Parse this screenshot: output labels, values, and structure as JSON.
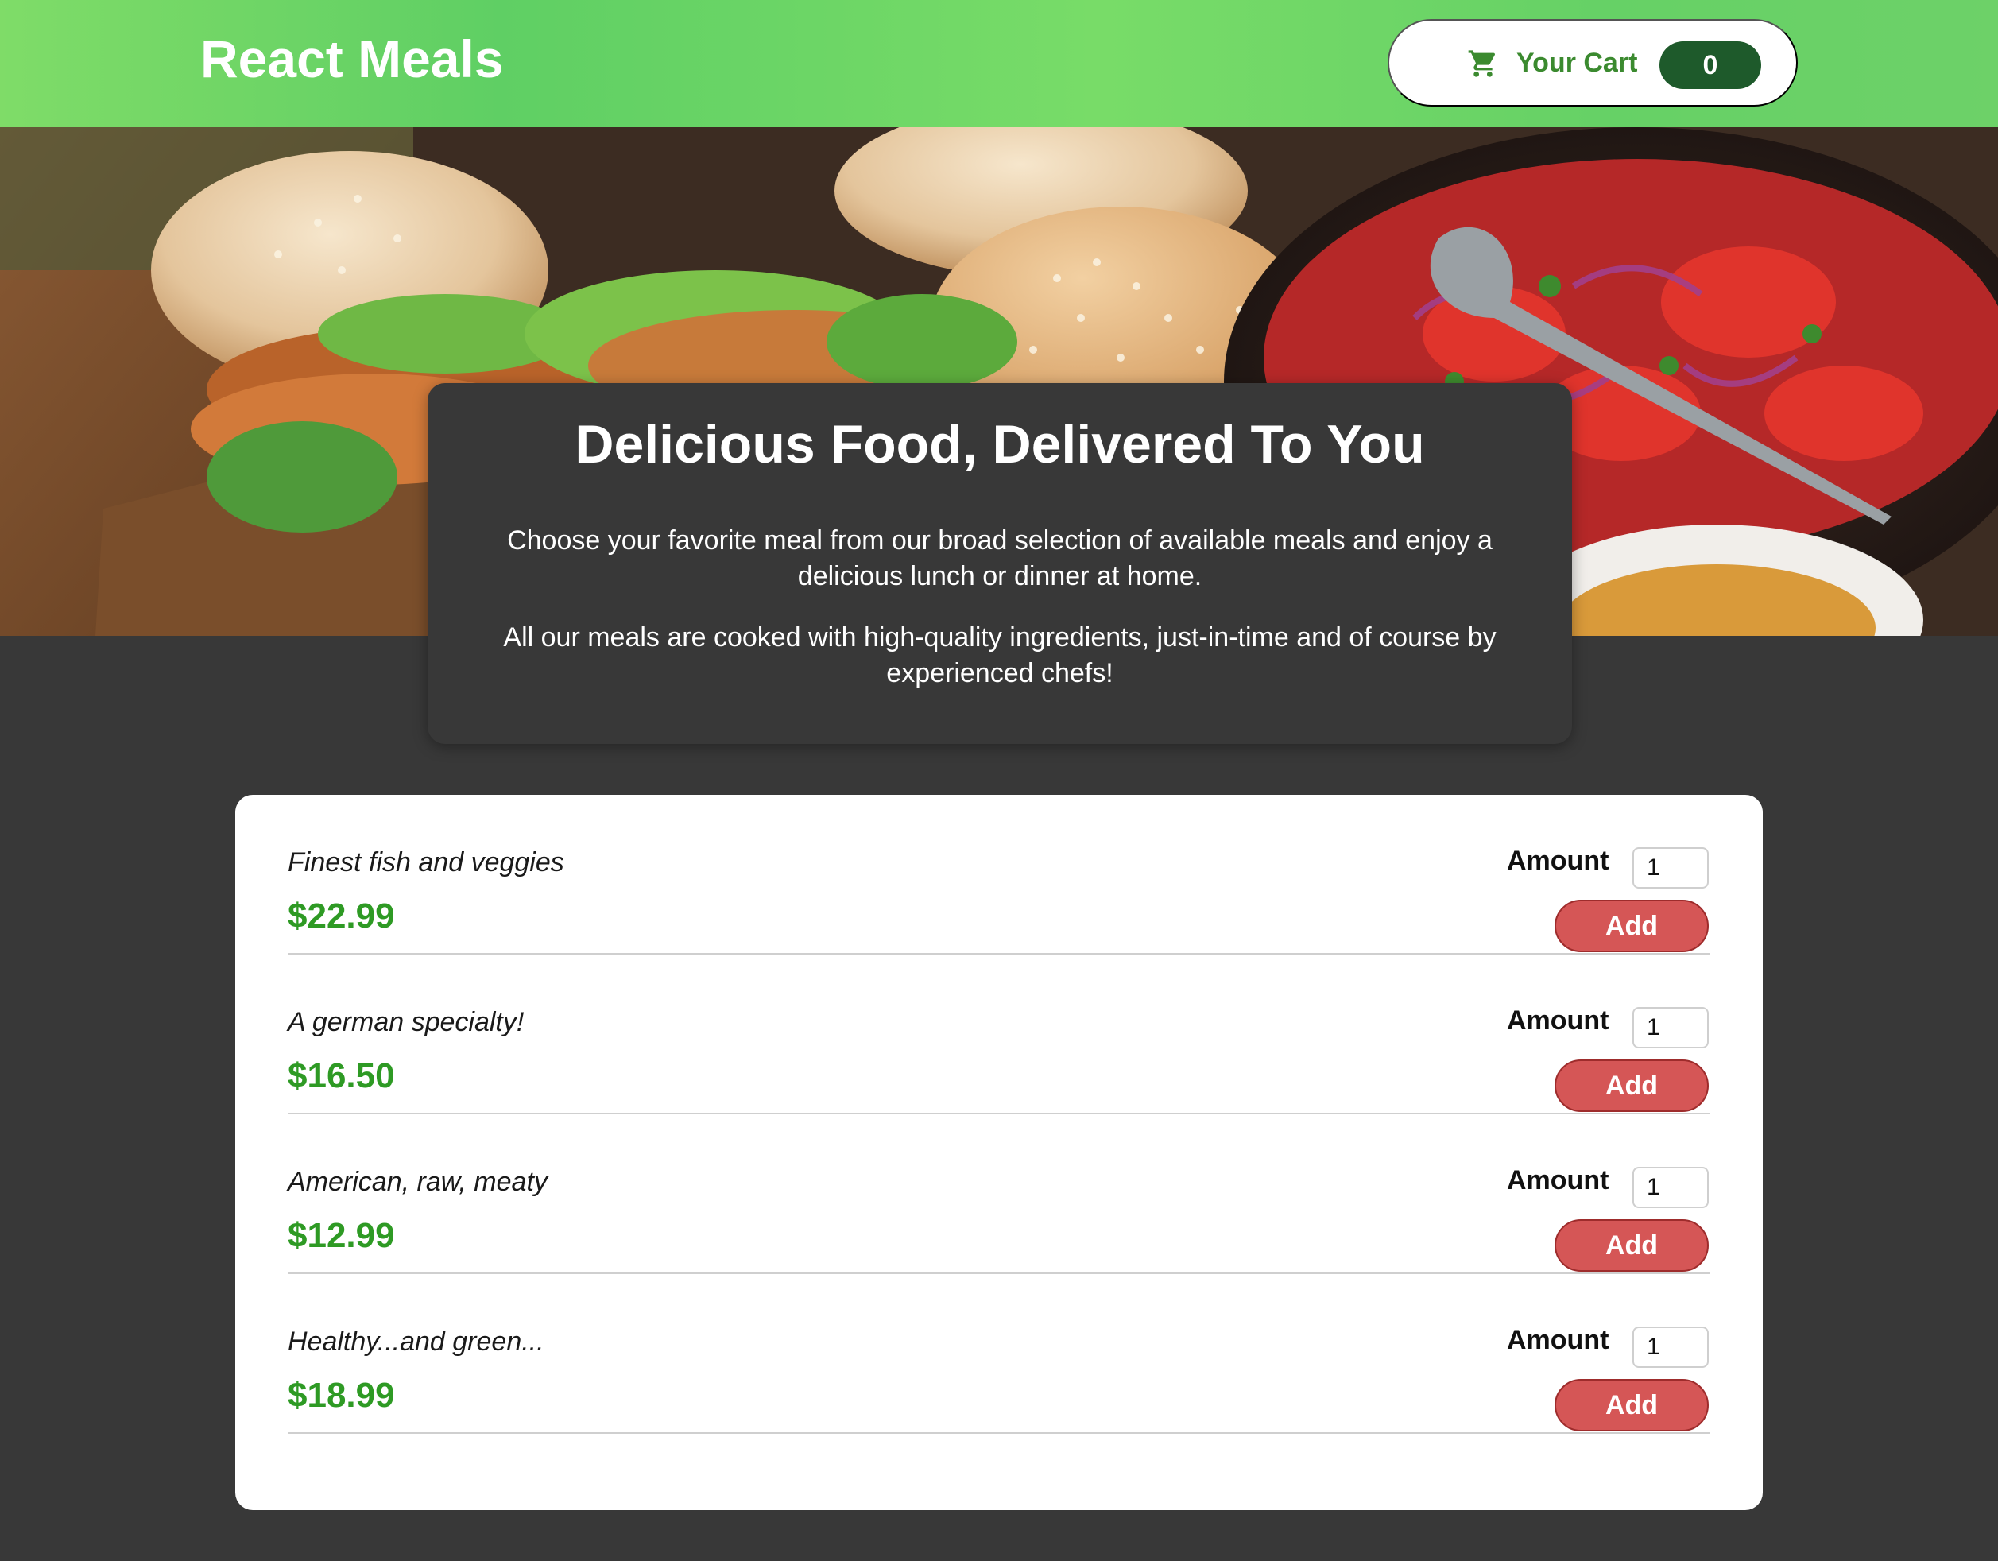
{
  "header": {
    "brand": "React Meals",
    "cart": {
      "label": "Your Cart",
      "count": "0",
      "icon": "shopping-cart-icon"
    }
  },
  "summary": {
    "title": "Delicious Food, Delivered To You",
    "paragraph1": "Choose your favorite meal from our broad selection of available meals and enjoy a delicious lunch or dinner at home.",
    "paragraph2": "All our meals are cooked with high-quality ingredients, just-in-time and of course by experienced chefs!"
  },
  "meals": [
    {
      "description": "Finest fish and veggies",
      "price": "$22.99",
      "amount_label": "Amount",
      "amount_value": "1",
      "add_label": "Add"
    },
    {
      "description": "A german specialty!",
      "price": "$16.50",
      "amount_label": "Amount",
      "amount_value": "1",
      "add_label": "Add"
    },
    {
      "description": "American, raw, meaty",
      "price": "$12.99",
      "amount_label": "Amount",
      "amount_value": "1",
      "add_label": "Add"
    },
    {
      "description": "Healthy...and green...",
      "price": "$18.99",
      "amount_label": "Amount",
      "amount_value": "1",
      "add_label": "Add"
    }
  ],
  "colors": {
    "header_green": "#6dd168",
    "cart_badge": "#1e5a2b",
    "price_green": "#2e9a24",
    "add_button": "#d55656",
    "page_background": "#383838"
  }
}
